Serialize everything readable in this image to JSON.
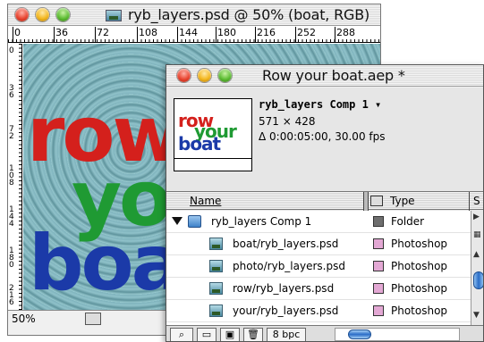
{
  "ps_window": {
    "title": "ryb_layers.psd @ 50% (boat, RGB)",
    "ruler_top": [
      "0",
      "36",
      "72",
      "108",
      "144",
      "180",
      "216",
      "252",
      "288"
    ],
    "ruler_left": [
      "0",
      "36",
      "72",
      "108",
      "144",
      "180",
      "216"
    ],
    "canvas_words": [
      "row",
      "your",
      "boat"
    ],
    "zoom": "50%"
  },
  "ae_window": {
    "title": "Row your boat.aep *",
    "comp": {
      "name": "ryb_layers Comp 1 ▾",
      "size": "571 × 428",
      "duration": "Δ 0:00:05:00, 30.00 fps"
    },
    "thumb_words": [
      "row",
      "your",
      "boat"
    ],
    "columns": {
      "name": "Name",
      "label_icon": "label-icon",
      "type": "Type",
      "extra": "S"
    },
    "items": [
      {
        "name": "ryb_layers Comp 1",
        "type": "Folder",
        "kind": "folder",
        "label_color": "#6e6e6e"
      },
      {
        "name": "boat/ryb_layers.psd",
        "type": "Photoshop",
        "kind": "psd",
        "label_color": "#e3a8d4"
      },
      {
        "name": "photo/ryb_layers.psd",
        "type": "Photoshop",
        "kind": "psd",
        "label_color": "#e3a8d4"
      },
      {
        "name": "row/ryb_layers.psd",
        "type": "Photoshop",
        "kind": "psd",
        "label_color": "#e3a8d4"
      },
      {
        "name": "your/ryb_layers.psd",
        "type": "Photoshop",
        "kind": "psd",
        "label_color": "#e3a8d4"
      }
    ],
    "footer": {
      "bpc": "8 bpc"
    }
  },
  "colors": {
    "word_red": "#d4201c",
    "word_green": "#1f9a33",
    "word_blue": "#1b3aa8",
    "aqua_blue": "#2a6dc7"
  }
}
